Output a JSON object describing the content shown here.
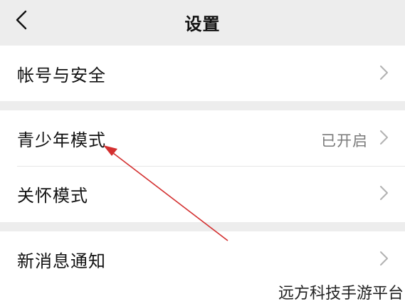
{
  "header": {
    "title": "设置",
    "back_icon": "chevron-left-icon"
  },
  "groups": [
    {
      "items": [
        {
          "label": "帐号与安全",
          "value": ""
        }
      ]
    },
    {
      "items": [
        {
          "label": "青少年模式",
          "value": "已开启"
        },
        {
          "label": "关怀模式",
          "value": ""
        }
      ]
    },
    {
      "items": [
        {
          "label": "新消息通知",
          "value": ""
        }
      ]
    }
  ],
  "annotation": {
    "arrow_color": "#d32f2f"
  },
  "watermark": "远方科技手游平台",
  "colors": {
    "background": "#ededed",
    "card": "#ffffff",
    "text": "#111111",
    "secondary_text": "#7a7a7a",
    "chevron": "#b2b2b2"
  }
}
